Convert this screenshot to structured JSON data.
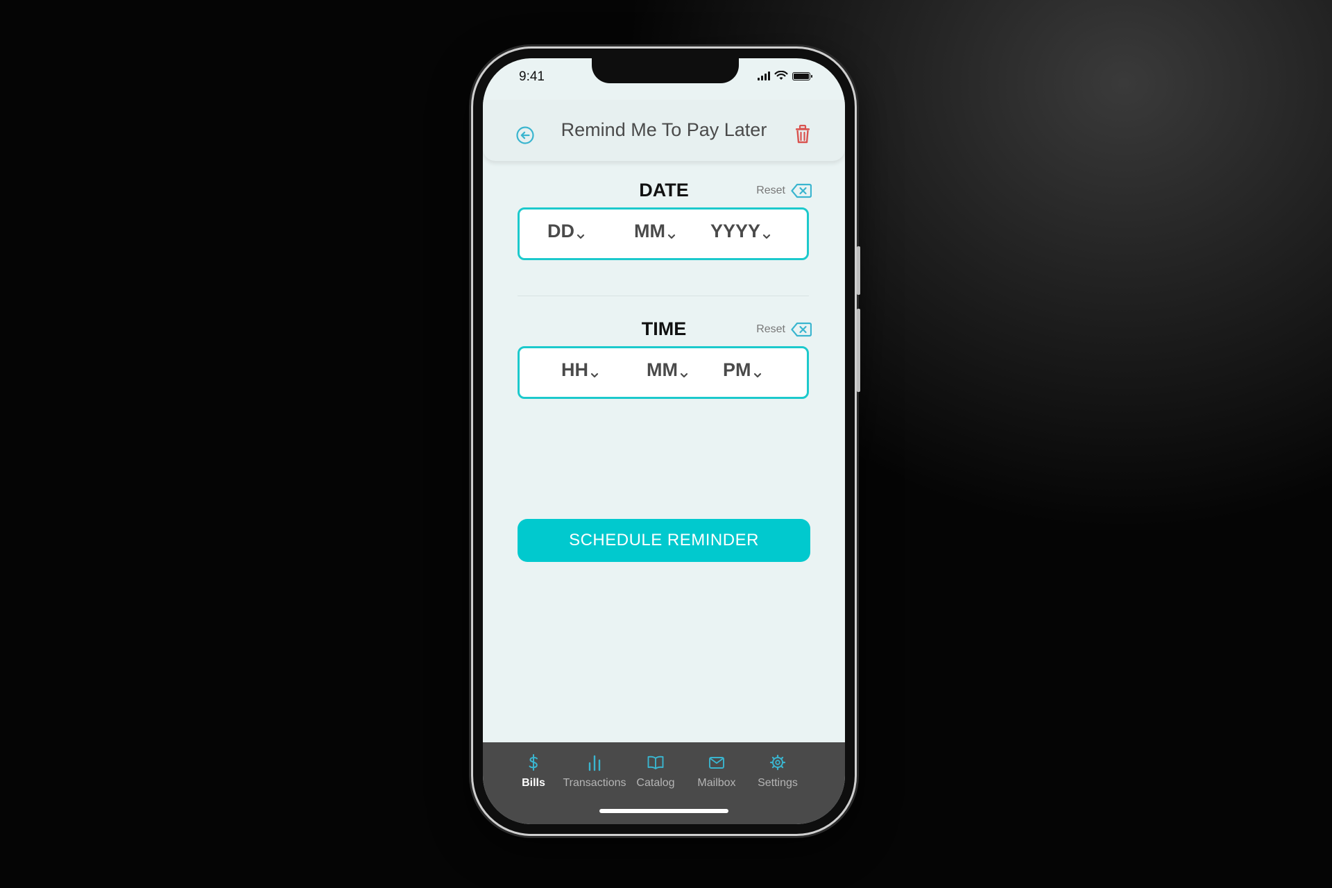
{
  "status_bar": {
    "time": "9:41"
  },
  "header": {
    "title": "Remind Me To Pay Later"
  },
  "date_section": {
    "title": "DATE",
    "reset_label": "Reset",
    "fields": [
      "DD",
      "MM",
      "YYYY"
    ]
  },
  "time_section": {
    "title": "TIME",
    "reset_label": "Reset",
    "fields": [
      "HH",
      "MM",
      "PM"
    ]
  },
  "cta": {
    "label": "SCHEDULE REMINDER"
  },
  "tabs": [
    {
      "label": "Bills",
      "icon": "dollar-icon",
      "active": true
    },
    {
      "label": "Transactions",
      "icon": "bar-chart-icon",
      "active": false
    },
    {
      "label": "Catalog",
      "icon": "book-icon",
      "active": false
    },
    {
      "label": "Mailbox",
      "icon": "mail-icon",
      "active": false
    },
    {
      "label": "Settings",
      "icon": "gear-icon",
      "active": false
    }
  ],
  "colors": {
    "accent": "#01c9ce",
    "delete": "#d9534f",
    "tabbar": "#4a4a4a",
    "screen_bg": "#eaf3f3"
  }
}
